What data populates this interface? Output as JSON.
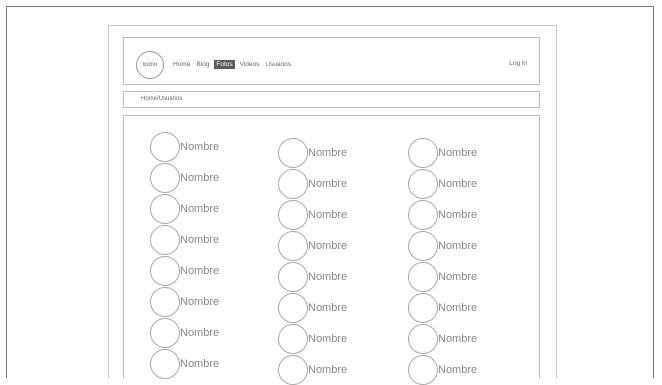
{
  "navbar": {
    "logo_label": "icono",
    "links": [
      "Home",
      "Blog",
      "Fotos",
      "Videos",
      "Usuarios"
    ],
    "active_link": "Fotos",
    "login_label": "Log in"
  },
  "breadcrumb": "Home/Usuarios",
  "users": {
    "name_label": "Nombre",
    "columns": [
      [
        "Nombre",
        "Nombre",
        "Nombre",
        "Nombre",
        "Nombre",
        "Nombre",
        "Nombre",
        "Nombre"
      ],
      [
        "Nombre",
        "Nombre",
        "Nombre",
        "Nombre",
        "Nombre",
        "Nombre",
        "Nombre",
        "Nombre"
      ],
      [
        "Nombre",
        "Nombre",
        "Nombre",
        "Nombre",
        "Nombre",
        "Nombre",
        "Nombre",
        "Nombre"
      ]
    ]
  }
}
